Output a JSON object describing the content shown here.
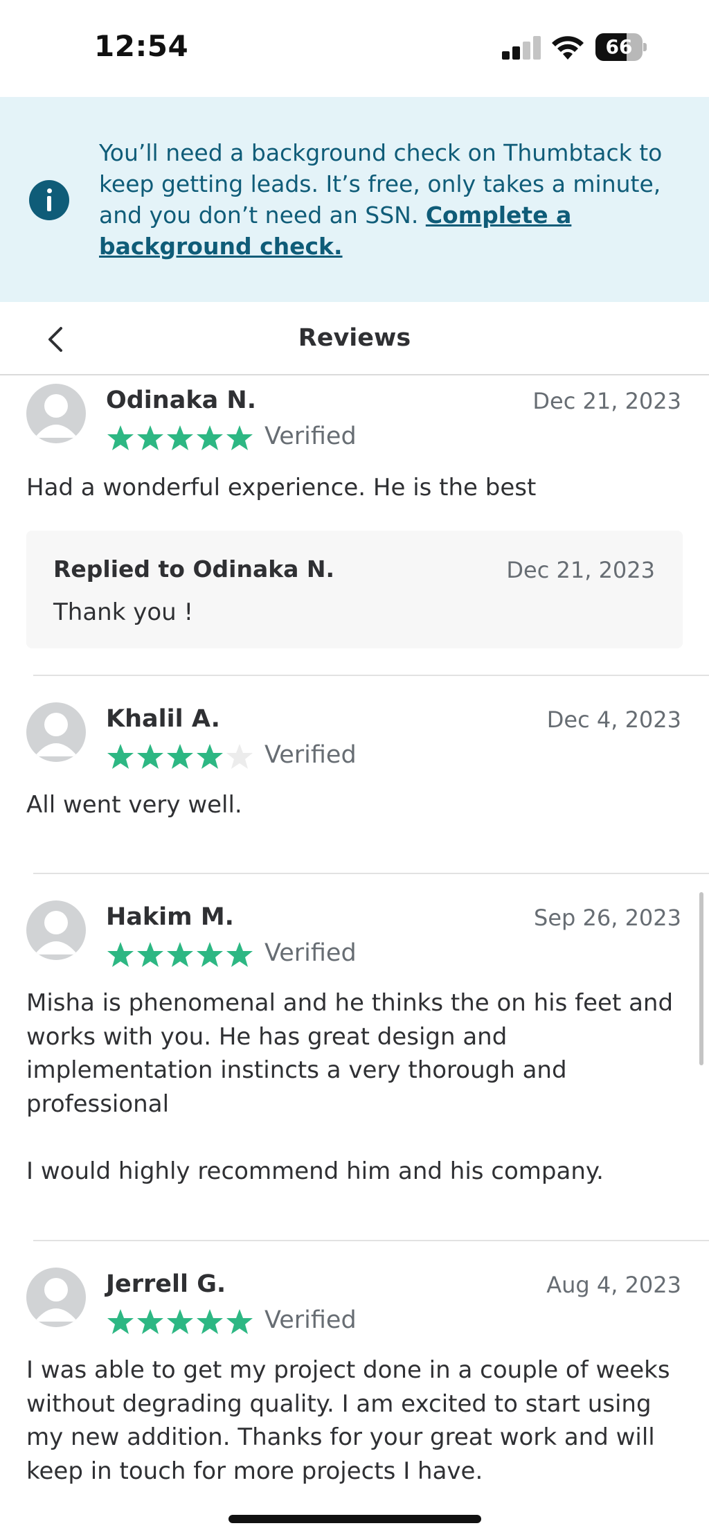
{
  "status_bar": {
    "time": "12:54",
    "battery_level": "66",
    "battery_fraction": 0.66
  },
  "banner": {
    "message": "You’ll need a background check on Thumbtack to keep getting leads. It’s free, only takes a minute, and you don’t need an SSN.",
    "link_text": "Complete a background check.",
    "icon": "info-icon",
    "color": "#0f5c78",
    "background": "#e4f3f8"
  },
  "nav": {
    "title": "Reviews",
    "back_icon": "chevron-left-icon"
  },
  "colors": {
    "star_filled": "#2db783",
    "star_empty": "#ececec",
    "avatar": "#d1d3d5"
  },
  "reviews": [
    {
      "name": "Odinaka N.",
      "date": "Dec 21, 2023",
      "rating": 5,
      "verified": "Verified",
      "body": "Had a wonderful experience. He is the best",
      "reply": {
        "title": "Replied to Odinaka N.",
        "date": "Dec 21, 2023",
        "body": "Thank you !"
      }
    },
    {
      "name": "Khalil A.",
      "date": "Dec 4, 2023",
      "rating": 4,
      "verified": "Verified",
      "body": "All went very well."
    },
    {
      "name": "Hakim M.",
      "date": "Sep 26, 2023",
      "rating": 5,
      "verified": "Verified",
      "body": "Misha is phenomenal and he thinks the on his feet and works with you. He has great design and implementation instincts a very thorough and professional\n\nI would highly recommend him and his company."
    },
    {
      "name": "Jerrell G.",
      "date": "Aug 4, 2023",
      "rating": 5,
      "verified": "Verified",
      "body": "I was able to get my project done in a couple of weeks without degrading quality. I am excited to start using my new addition. Thanks for your great work and will keep in touch for more projects I have."
    }
  ]
}
